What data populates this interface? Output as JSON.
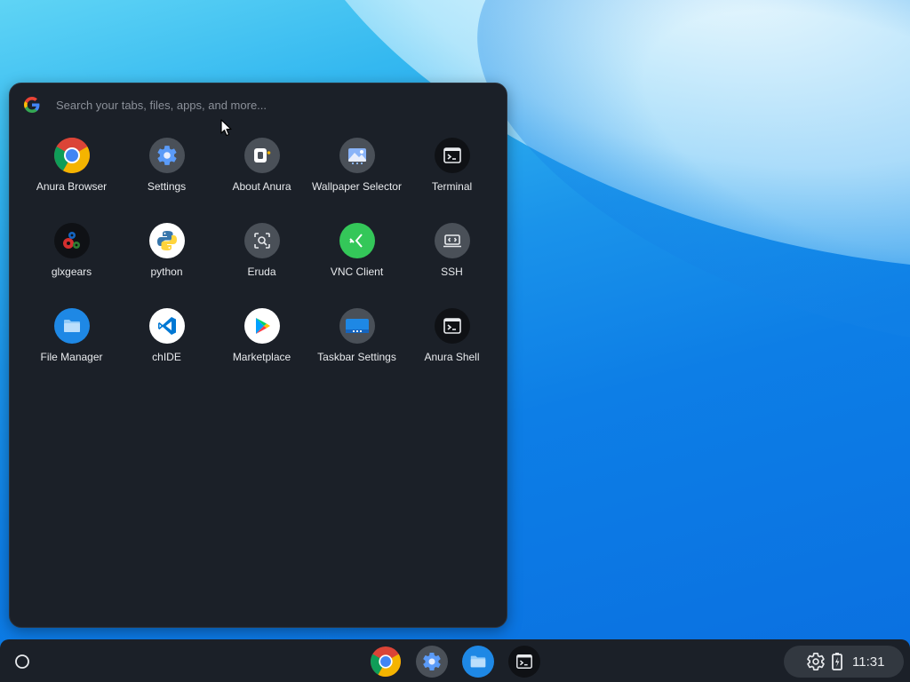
{
  "search": {
    "placeholder": "Search your tabs, files, apps, and more..."
  },
  "apps": [
    {
      "label": "Anura Browser",
      "icon": "chrome-icon"
    },
    {
      "label": "Settings",
      "icon": "gear-icon"
    },
    {
      "label": "About Anura",
      "icon": "anura-logo-icon"
    },
    {
      "label": "Wallpaper Selector",
      "icon": "wallpaper-icon"
    },
    {
      "label": "Terminal",
      "icon": "terminal-icon"
    },
    {
      "label": "glxgears",
      "icon": "gears-icon"
    },
    {
      "label": "python",
      "icon": "python-icon"
    },
    {
      "label": "Eruda",
      "icon": "inspect-icon"
    },
    {
      "label": "VNC Client",
      "icon": "vnc-icon"
    },
    {
      "label": "SSH",
      "icon": "ssh-icon"
    },
    {
      "label": "File Manager",
      "icon": "folder-icon"
    },
    {
      "label": "chIDE",
      "icon": "vscode-icon"
    },
    {
      "label": "Marketplace",
      "icon": "play-store-icon"
    },
    {
      "label": "Taskbar Settings",
      "icon": "taskbar-settings-icon"
    },
    {
      "label": "Anura Shell",
      "icon": "terminal-icon"
    }
  ],
  "taskbar": {
    "pinned": [
      "chrome-icon",
      "gear-icon",
      "folder-icon",
      "terminal-icon"
    ],
    "tray_icons": [
      "gear-icon",
      "battery-icon"
    ],
    "clock": "11:31"
  },
  "colors": {
    "panel_bg": "#1b2028",
    "accent_blue": "#1e88e5",
    "vnc_green": "#34c759"
  }
}
